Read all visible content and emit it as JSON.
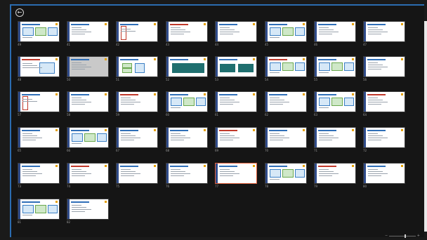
{
  "app": {
    "back_icon": "back-arrow-icon",
    "back_glyph": "←"
  },
  "slides": [
    {
      "num": "49"
    },
    {
      "num": "41"
    },
    {
      "num": "42"
    },
    {
      "num": "43"
    },
    {
      "num": "44"
    },
    {
      "num": "45"
    },
    {
      "num": "46"
    },
    {
      "num": "47"
    },
    {
      "num": "48"
    },
    {
      "num": "50"
    },
    {
      "num": "51"
    },
    {
      "num": "52"
    },
    {
      "num": "53"
    },
    {
      "num": "54"
    },
    {
      "num": "55"
    },
    {
      "num": "56"
    },
    {
      "num": "57"
    },
    {
      "num": "58"
    },
    {
      "num": "59"
    },
    {
      "num": "60"
    },
    {
      "num": "61"
    },
    {
      "num": "62"
    },
    {
      "num": "63"
    },
    {
      "num": "64"
    },
    {
      "num": "65"
    },
    {
      "num": "66"
    },
    {
      "num": "67"
    },
    {
      "num": "68"
    },
    {
      "num": "69"
    },
    {
      "num": "70"
    },
    {
      "num": "71"
    },
    {
      "num": "72"
    },
    {
      "num": "73"
    },
    {
      "num": "74"
    },
    {
      "num": "75"
    },
    {
      "num": "76"
    },
    {
      "num": "77"
    },
    {
      "num": "78"
    },
    {
      "num": "79"
    },
    {
      "num": "80"
    },
    {
      "num": "81"
    },
    {
      "num": "82"
    }
  ],
  "selected_slide": "77",
  "zoom": {
    "minus": "−",
    "plus": "+"
  }
}
